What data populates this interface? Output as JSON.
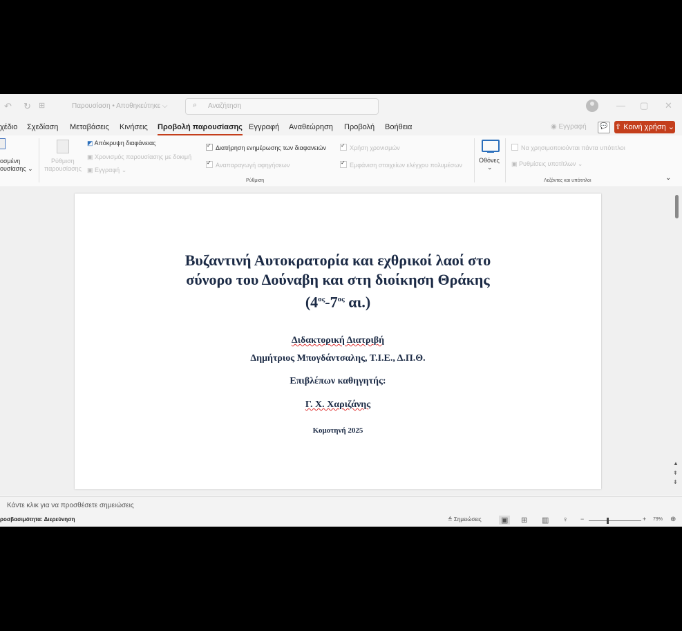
{
  "titlebar": {
    "undo_icon": "↶",
    "redo_icon": "↻",
    "doc_name": "Παρουσίαση • Αποθηκεύτηκε ⌵",
    "search_placeholder": "Αναζήτηση"
  },
  "tabs": [
    "χέδιο",
    "Σχεδίαση",
    "Μεταβάσεις",
    "Κινήσεις",
    "Προβολή παρουσίασης",
    "Εγγραφή",
    "Αναθεώρηση",
    "Προβολή",
    "Βοήθεια"
  ],
  "active_tab": "Προβολή παρουσίασης",
  "header_right": {
    "record": "◉ Εγγραφή",
    "comment": "💬",
    "share": "⇧ Κοινή χρήση ⌄"
  },
  "ribbon": {
    "left_partial": [
      "οσμένη",
      "ουσίασης ⌄"
    ],
    "setup_show": [
      "Ρύθμιση",
      "παρουσίασης"
    ],
    "hide_slide": "Απόκρυψη διαφάνειας",
    "rehearse": "Χρονισμός παρουσίασης με δοκιμή",
    "record": "Εγγραφή",
    "keep_updated": "Διατήρηση ενημέρωσης των διαφανειών",
    "play_narrations": "Αναπαραγωγή αφηγήσεων",
    "use_timings": "Χρήση χρονισμών",
    "show_media_controls": "Εμφάνιση στοιχείων ελέγχου πολυμέσων",
    "group_setup": "Ρύθμιση",
    "monitors": "Οθόνες",
    "always_subtitles": "Να χρησιμοποιούνται πάντα υπότιτλοι",
    "subtitle_settings": "Ρυθμίσεις υποτίτλων ⌄",
    "group_captions": "Λεζάντες και υπότιτλοι"
  },
  "slide": {
    "title_lines": [
      "Βυζαντινή Αυτοκρατορία και εχθρικοί λαοί στο",
      "σύνορο του Δούναβη και στη διοίκηση Θράκης"
    ],
    "period_a": "(4",
    "period_sup1": "ος",
    "period_b": "-7",
    "period_sup2": "ος",
    "period_c": " αι.)",
    "thesis": "Διδακτορική Διατριβή",
    "author": "Δημήτριος Μπογδάντσαλης, Τ.Ι.Ε., Δ.Π.Θ.",
    "supervisor_label": "Επιβλέπων καθηγητής:",
    "supervisor": "Γ. Χ. Χαριζάνης",
    "place_year": "Κομοτηνή 2025"
  },
  "notes_placeholder": "Κάντε κλικ για να προσθέσετε σημειώσεις",
  "status": {
    "accessibility": "ροσβασιμότητα: Διερεύνηση",
    "notes_btn": "≜ Σημειώσεις",
    "zoom": "79%"
  }
}
